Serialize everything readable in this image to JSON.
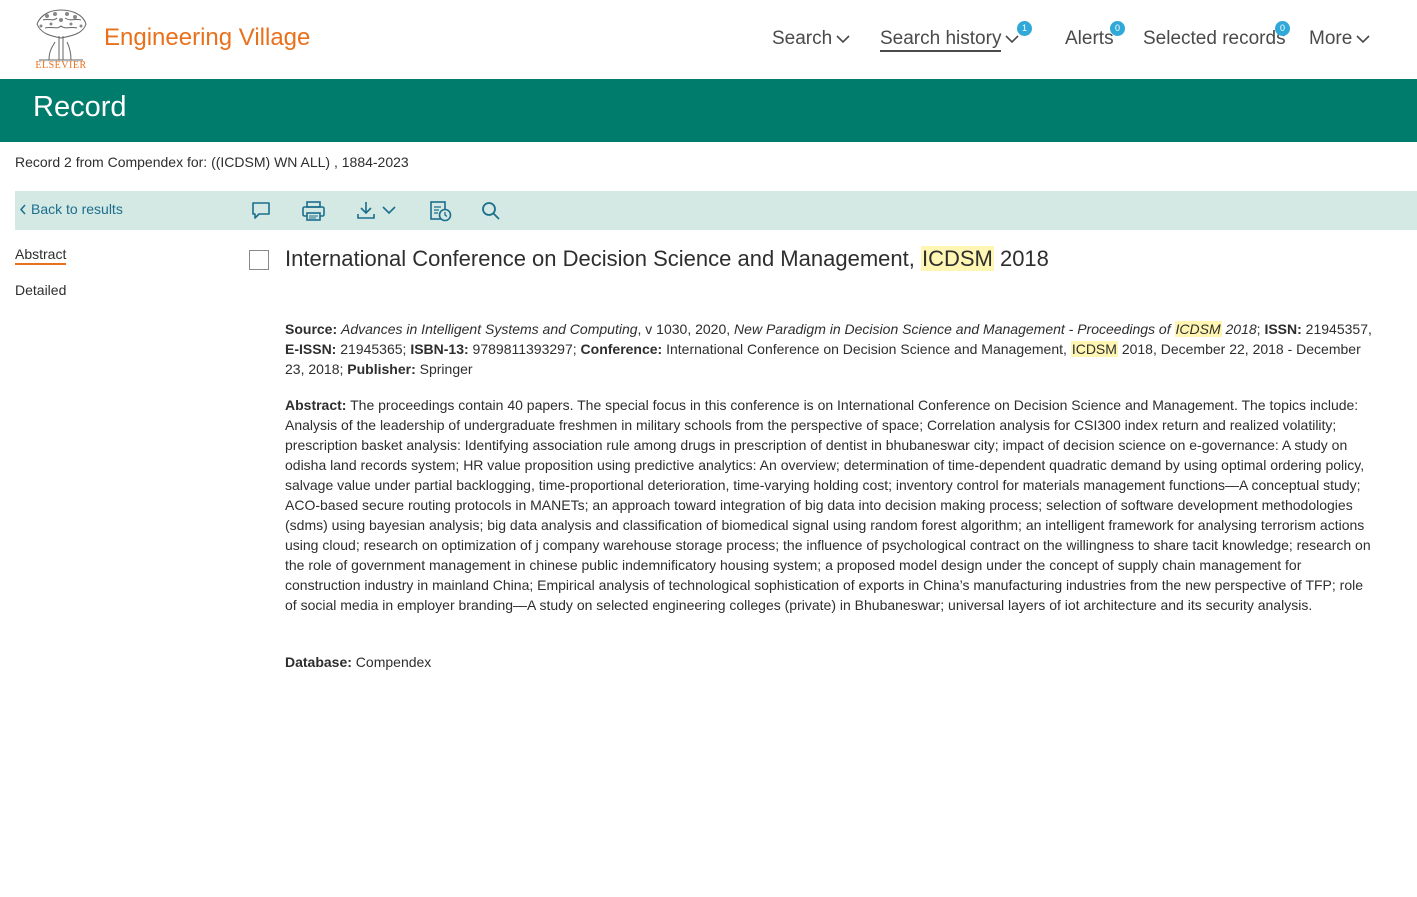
{
  "header": {
    "logo_word": "ELSEVIER",
    "brand": "Engineering Village",
    "nav": {
      "search": "Search",
      "search_history": "Search history",
      "search_history_count": "1",
      "alerts": "Alerts",
      "alerts_count": "0",
      "selected_records": "Selected records",
      "selected_records_count": "0",
      "more": "More"
    }
  },
  "titlebar": {
    "title": "Record"
  },
  "record_info": "Record 2 from Compendex for: ((ICDSM) WN ALL) , 1884-2023",
  "toolbar": {
    "back": "Back to results",
    "icons": [
      "comment-icon",
      "print-icon",
      "download-icon",
      "history-icon",
      "search-icon"
    ]
  },
  "sidenav": {
    "abstract": "Abstract",
    "detailed": "Detailed"
  },
  "record": {
    "title_before": "International Conference on Decision Science and Management, ",
    "title_highlight": "ICDSM",
    "title_after": " 2018",
    "source_label": "Source:",
    "source_series": "Advances in Intelligent Systems and Computing",
    "source_volume": ", v 1030, 2020, ",
    "source_proceedings": "New Paradigm in Decision Science and Management - Proceedings of ",
    "source_highlight": "ICDSM",
    "source_proceedings_year": " 2018",
    "source_sep": ";  ",
    "issn_label": "ISSN:",
    "issn": " 21945357,  ",
    "eissn_label": "E-ISSN:",
    "eissn": " 21945365;  ",
    "isbn_label": "ISBN-13:",
    "isbn": " 9789811393297; ",
    "conference_label": "Conference:",
    "conference_before": " International Conference on Decision Science and Management, ",
    "conference_highlight": "ICDSM",
    "conference_after": " 2018, December 22, 2018 - December 23, 2018; ",
    "publisher_label": "Publisher:",
    "publisher": " Springer",
    "abstract_label": "Abstract:",
    "abstract": " The proceedings contain 40 papers. The special focus in this conference is on International Conference on Decision Science and Management. The topics include: Analysis of the leadership of undergraduate freshmen in military schools from the perspective of space; Correlation analysis for CSI300 index return and realized volatility; prescription basket analysis: Identifying association rule among drugs in prescription of dentist in bhubaneswar city; impact of decision science on e-governance: A study on odisha land records system; HR value proposition using predictive analytics: An overview; determination of time-dependent quadratic demand by using optimal ordering policy, salvage value under partial backlogging, time-proportional deterioration, time-varying holding cost; inventory control for materials management functions—A conceptual study; ACO-based secure routing protocols in MANETs; an approach toward integration of big data into decision making process; selection of software development methodologies (sdms) using bayesian analysis; big data analysis and classification of biomedical signal using random forest algorithm; an intelligent framework for analysing terrorism actions using cloud; research on optimization of j company warehouse storage process; the influence of psychological contract on the willingness to share tacit knowledge; research on the role of government management in chinese public indemnificatory housing system; a proposed model design under the concept of supply chain management for construction industry in mainland China; Empirical analysis of technological sophistication of exports in China’s manufacturing industries from the new perspective of TFP; role of social media in employer branding—A study on selected engineering colleges (private) in Bhubaneswar; universal layers of iot architecture and its security analysis.",
    "database_label": "Database:",
    "database": " Compendex"
  },
  "colors": {
    "brand_orange": "#e9711c",
    "teal": "#007c6d",
    "toolbar_bg": "#d4e9e3",
    "link": "#1b6e8e",
    "highlight": "#fff6b3",
    "badge": "#30a9d8"
  }
}
